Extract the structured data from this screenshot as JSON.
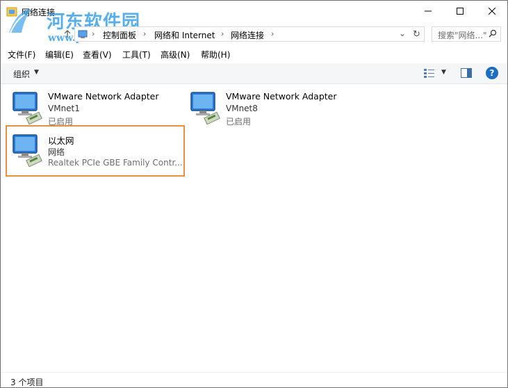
{
  "window": {
    "title": "网络连接"
  },
  "watermark": {
    "title": "河东软件园",
    "url": "www.pc0359.cn"
  },
  "address": {
    "crumbs": [
      "控制面板",
      "网络和 Internet",
      "网络连接"
    ],
    "search_placeholder": "搜索\"网络...\""
  },
  "menu": {
    "items": [
      "文件(F)",
      "编辑(E)",
      "查看(V)",
      "工具(T)",
      "高级(N)",
      "帮助(H)"
    ]
  },
  "toolbar": {
    "organize_label": "组织",
    "help_label": "?"
  },
  "connections": [
    {
      "name": "VMware Network Adapter",
      "line2": "VMnet1",
      "line3": "已启用",
      "icon": "network-adapter-icon"
    },
    {
      "name": "VMware Network Adapter",
      "line2": "VMnet8",
      "line3": "已启用",
      "icon": "network-adapter-icon"
    },
    {
      "name": "以太网",
      "line2": "网络",
      "line3": "Realtek PCIe GBE Family Contr...",
      "icon": "network-adapter-icon",
      "highlighted": true
    }
  ],
  "status": {
    "item_count": "3 个项目"
  },
  "colors": {
    "highlight_border": "#e8923d",
    "help_blue": "#1b6ec2",
    "watermark": "#3aa0e8"
  }
}
